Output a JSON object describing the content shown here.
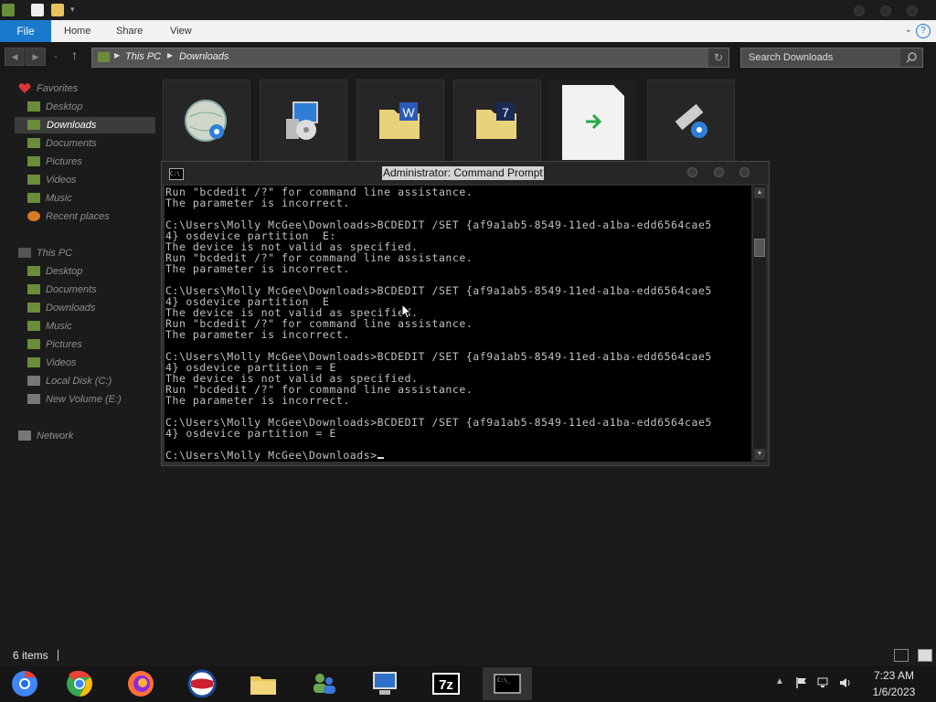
{
  "ribbon": {
    "file": "File",
    "home": "Home",
    "share": "Share",
    "view": "View"
  },
  "address": {
    "crumbs": [
      "This PC",
      "Downloads"
    ],
    "search_placeholder": "Search Downloads"
  },
  "sidebar": {
    "favorites": {
      "label": "Favorites",
      "items": [
        "Desktop",
        "Downloads",
        "Documents",
        "Pictures",
        "Videos",
        "Music",
        "Recent places"
      ]
    },
    "this_pc": {
      "label": "This PC",
      "items": [
        "Desktop",
        "Documents",
        "Downloads",
        "Music",
        "Pictures",
        "Videos",
        "Local Disk (C:)",
        "New Volume (E:)"
      ]
    },
    "network": "Network"
  },
  "files": [
    {
      "icon": "globe-gear-icon"
    },
    {
      "icon": "setup-disc-icon"
    },
    {
      "icon": "word-folder-icon"
    },
    {
      "icon": "seven-zip-folder-icon"
    },
    {
      "icon": "shortcut-file-icon"
    },
    {
      "icon": "usb-gear-icon"
    }
  ],
  "cmd": {
    "title": "Administrator: Command Prompt",
    "lines": [
      "Run \"bcdedit /?\" for command line assistance.",
      "The parameter is incorrect.",
      "",
      "C:\\Users\\Molly McGee\\Downloads>BCDEDIT /SET {af9a1ab5-8549-11ed-a1ba-edd6564cae5",
      "4} osdevice partition  E:",
      "The device is not valid as specified.",
      "Run \"bcdedit /?\" for command line assistance.",
      "The parameter is incorrect.",
      "",
      "C:\\Users\\Molly McGee\\Downloads>BCDEDIT /SET {af9a1ab5-8549-11ed-a1ba-edd6564cae5",
      "4} osdevice partition  E",
      "The device is not valid as specified.",
      "Run \"bcdedit /?\" for command line assistance.",
      "The parameter is incorrect.",
      "",
      "C:\\Users\\Molly McGee\\Downloads>BCDEDIT /SET {af9a1ab5-8549-11ed-a1ba-edd6564cae5",
      "4} osdevice partition = E",
      "The device is not valid as specified.",
      "Run \"bcdedit /?\" for command line assistance.",
      "The parameter is incorrect.",
      "",
      "C:\\Users\\Molly McGee\\Downloads>BCDEDIT /SET {af9a1ab5-8549-11ed-a1ba-edd6564cae5",
      "4} osdevice partition = E",
      ""
    ],
    "prompt": "C:\\Users\\Molly McGee\\Downloads>"
  },
  "status": {
    "count": "6 items"
  },
  "taskbar": {
    "apps": [
      "chromium-icon",
      "chrome-icon",
      "firefox-icon",
      "opera-icon",
      "file-explorer-icon",
      "network-users-icon",
      "remote-desktop-icon",
      "seven-zip-icon",
      "command-prompt-icon"
    ],
    "time": "7:23 AM",
    "date": "1/6/2023"
  },
  "colors": {
    "accent": "#1979ca",
    "window_bg": "#1b1b1b",
    "console_text": "#c0c0c0"
  }
}
